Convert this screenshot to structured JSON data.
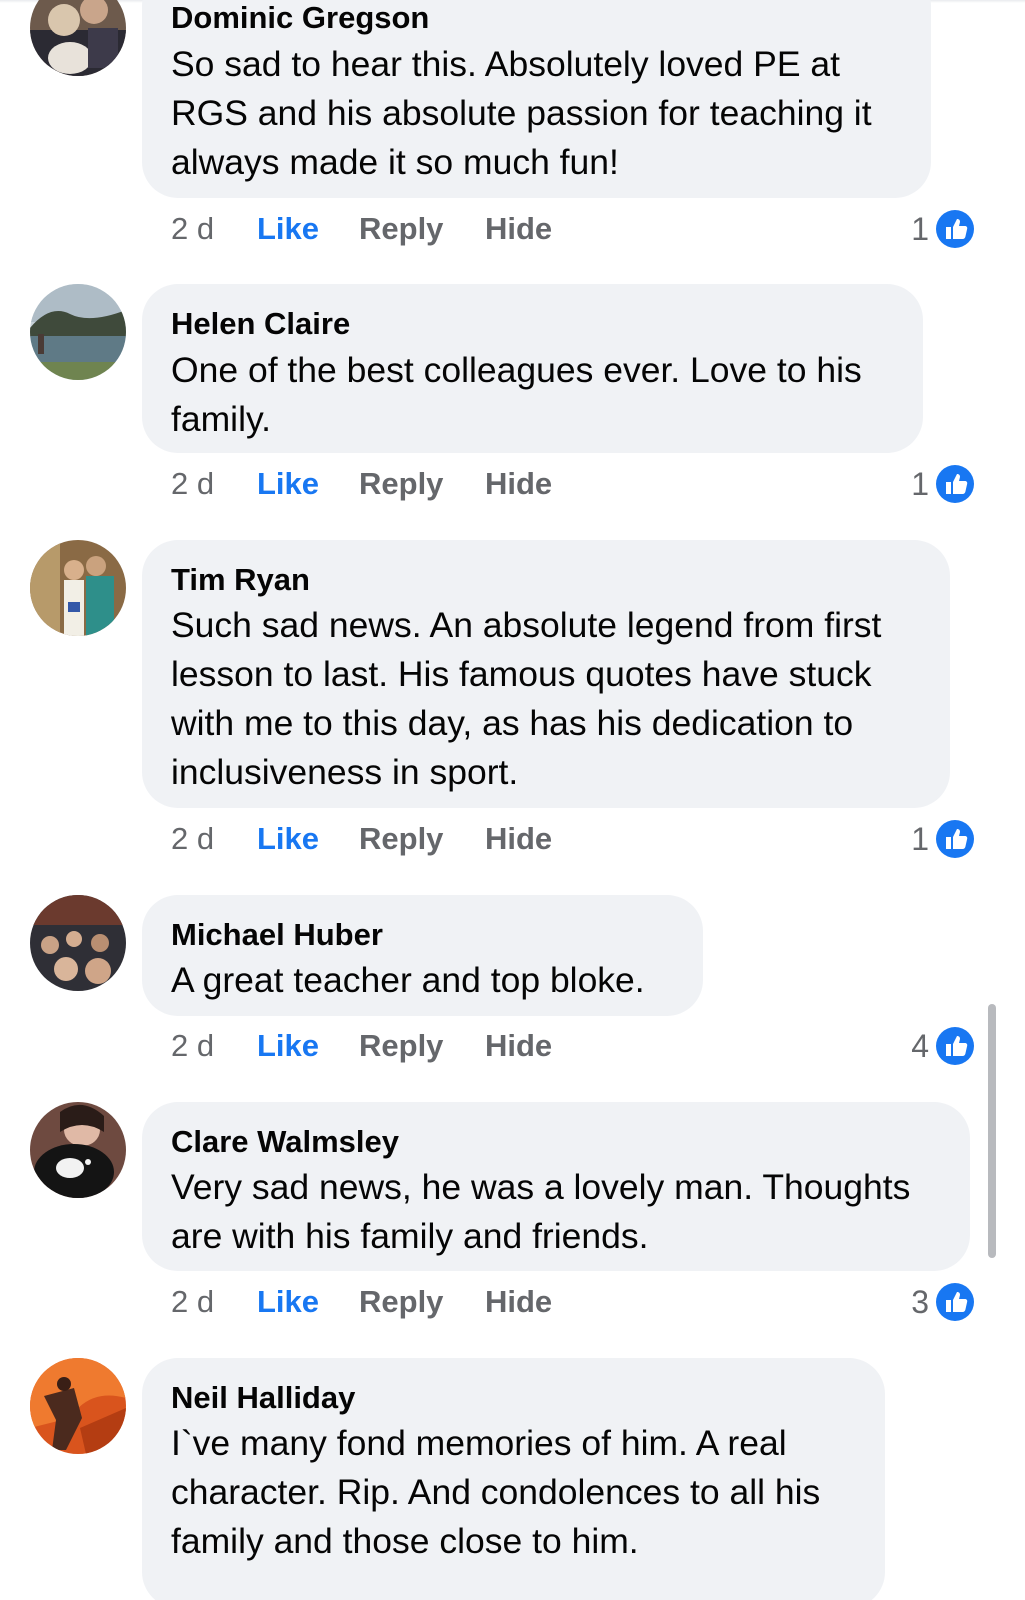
{
  "colors": {
    "bubble": "#f0f2f5",
    "like_blue": "#1877f2",
    "meta_gray": "#65676b",
    "text": "#050505"
  },
  "icons": {
    "like_badge": "thumbs-up-icon"
  },
  "comments": [
    {
      "author": "Dominic Gregson",
      "lines": [
        "So sad to hear this. Absolutely loved PE at",
        "RGS and his absolute passion for teaching it",
        "always made it so much fun!"
      ],
      "time": "2 d",
      "like_label": "Like",
      "reply_label": "Reply",
      "hide_label": "Hide",
      "reaction_count": "1"
    },
    {
      "author": "Helen Claire",
      "lines": [
        "One of the best colleagues ever. Love to his",
        "family."
      ],
      "time": "2 d",
      "like_label": "Like",
      "reply_label": "Reply",
      "hide_label": "Hide",
      "reaction_count": "1"
    },
    {
      "author": "Tim Ryan",
      "lines": [
        "Such sad news. An absolute legend from first",
        "lesson to last. His famous quotes have stuck",
        "with me to this day, as has his dedication to",
        "inclusiveness in sport."
      ],
      "time": "2 d",
      "like_label": "Like",
      "reply_label": "Reply",
      "hide_label": "Hide",
      "reaction_count": "1"
    },
    {
      "author": "Michael Huber",
      "lines": [
        "A great teacher and top bloke."
      ],
      "time": "2 d",
      "like_label": "Like",
      "reply_label": "Reply",
      "hide_label": "Hide",
      "reaction_count": "4"
    },
    {
      "author": "Clare Walmsley",
      "lines": [
        "Very sad news, he was a lovely man. Thoughts",
        "are with his family and friends."
      ],
      "time": "2 d",
      "like_label": "Like",
      "reply_label": "Reply",
      "hide_label": "Hide",
      "reaction_count": "3"
    },
    {
      "author": "Neil Halliday",
      "lines": [
        "I`ve many fond memories of him. A real",
        "character. Rip. And condolences to all his",
        "family and those close to him."
      ],
      "time": null,
      "like_label": null,
      "reply_label": null,
      "hide_label": null,
      "reaction_count": null
    }
  ]
}
